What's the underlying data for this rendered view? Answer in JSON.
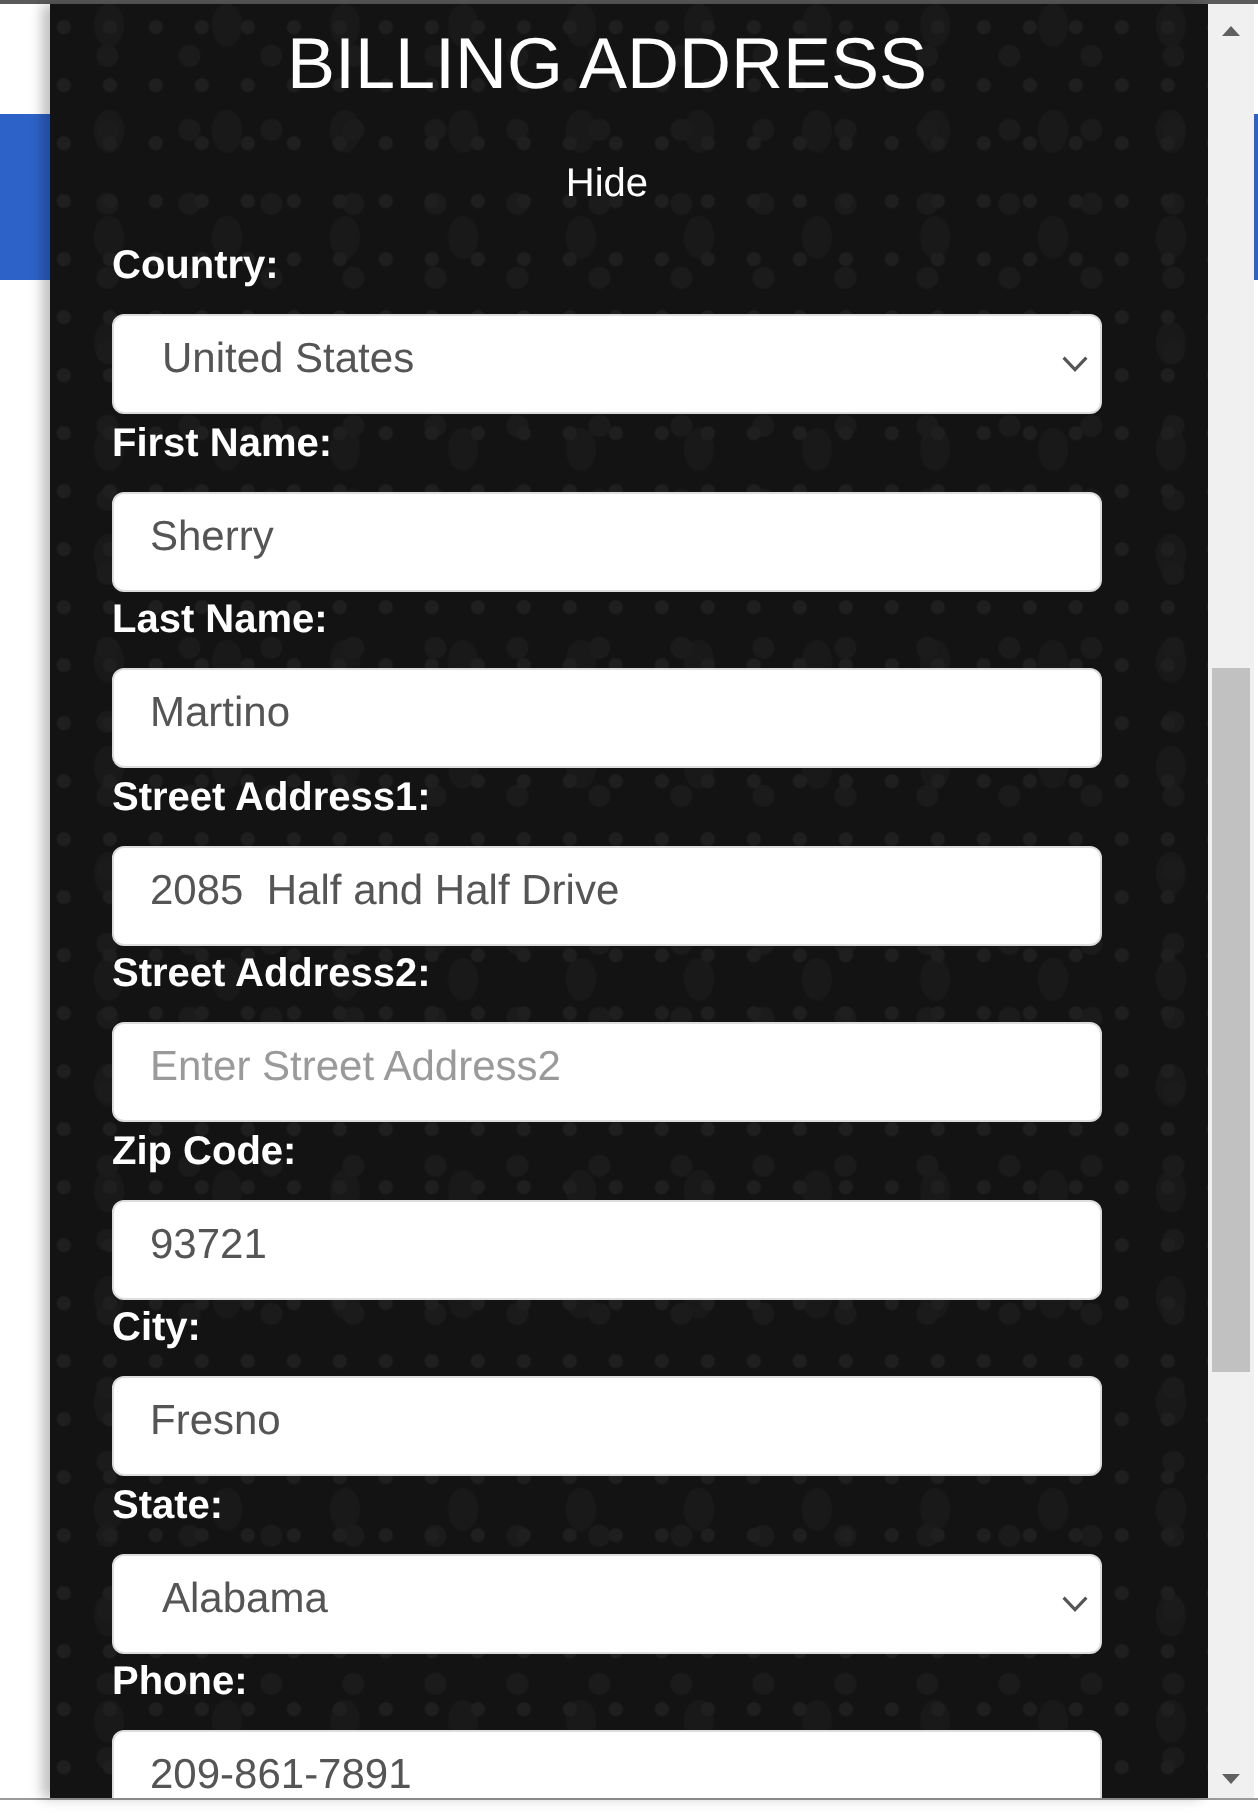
{
  "dialog": {
    "title": "BILLING ADDRESS",
    "toggle": "Hide"
  },
  "fields": [
    {
      "kind": "select",
      "label": "Country:",
      "value": "United States"
    },
    {
      "kind": "text",
      "label": "First Name:",
      "value": "Sherry"
    },
    {
      "kind": "text",
      "label": "Last Name:",
      "value": "Martino"
    },
    {
      "kind": "text",
      "label": "Street Address1:",
      "value": "2085  Half and Half Drive"
    },
    {
      "kind": "text",
      "label": "Street Address2:",
      "placeholder": "Enter Street Address2"
    },
    {
      "kind": "text",
      "label": "Zip Code:",
      "value": "93721"
    },
    {
      "kind": "text",
      "label": "City:",
      "value": "Fresno"
    },
    {
      "kind": "select",
      "label": "State:",
      "value": "Alabama"
    },
    {
      "kind": "text",
      "label": "Phone:",
      "value": "209-861-7891"
    }
  ]
}
